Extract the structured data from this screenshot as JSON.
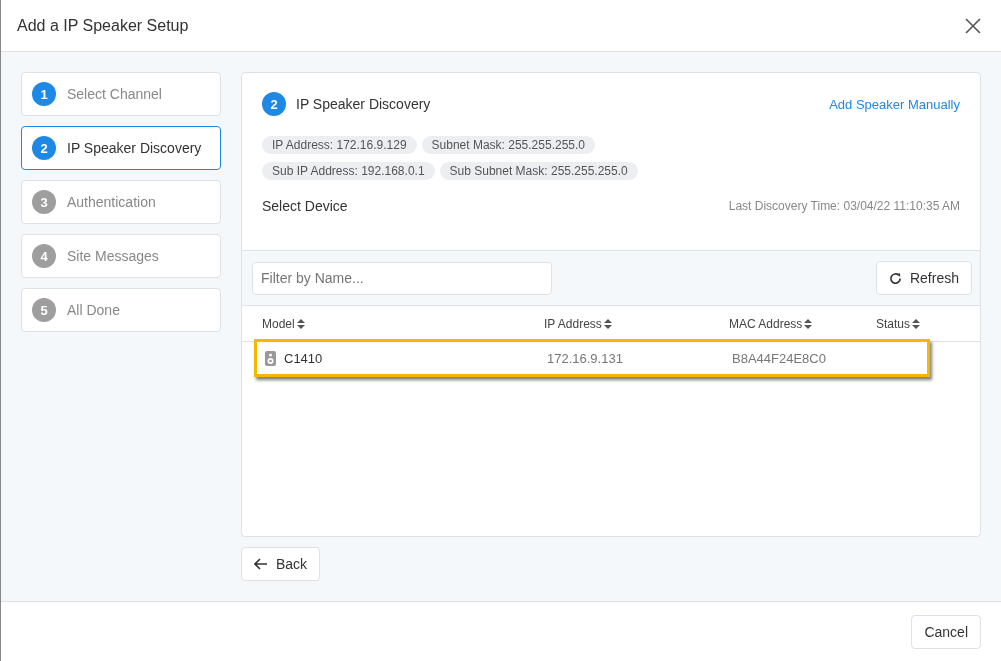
{
  "window": {
    "title": "Add a IP Speaker Setup"
  },
  "steps": [
    {
      "number": "1",
      "label": "Select Channel",
      "done": true,
      "selected": false
    },
    {
      "number": "2",
      "label": "IP Speaker Discovery",
      "done": true,
      "selected": true
    },
    {
      "number": "3",
      "label": "Authentication",
      "done": false,
      "selected": false
    },
    {
      "number": "4",
      "label": "Site Messages",
      "done": false,
      "selected": false
    },
    {
      "number": "5",
      "label": "All Done",
      "done": false,
      "selected": false
    }
  ],
  "panel": {
    "number": "2",
    "title": "IP Speaker Discovery",
    "link": "Add Speaker Manually",
    "chips": [
      [
        "IP Address: 172.16.9.129",
        "Subnet Mask: 255.255.255.0"
      ],
      [
        "Sub IP Address: 192.168.0.1",
        "Sub Subnet Mask: 255.255.255.0"
      ]
    ],
    "subtitle": "Select Device",
    "last_discovery": "Last Discovery Time: 03/04/22 11:10:35 AM"
  },
  "filter": {
    "placeholder": "Filter by Name..."
  },
  "refresh_button": "Refresh",
  "table": {
    "columns": [
      "Model",
      "IP Address",
      "MAC Address",
      "Status"
    ],
    "rows": [
      {
        "model": "C1410",
        "ip": "172.16.9.131",
        "mac": "B8A44F24E8C0",
        "highlighted": true
      }
    ]
  },
  "back_button": "Back",
  "cancel_button": "Cancel"
}
